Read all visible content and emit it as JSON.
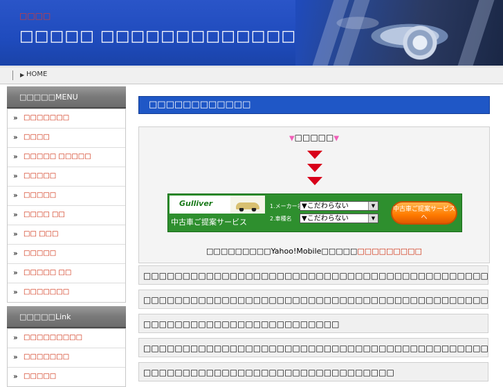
{
  "header": {
    "pretitle": "□□□□",
    "title": "□□□□□ □□□□□□□□□□□□□"
  },
  "breadcrumb": {
    "home": "HOME"
  },
  "sidebar": {
    "menu_title": "□□□□□MENU",
    "menu_items": [
      "□□□□□□□",
      "□□□□",
      "□□□□□ □□□□□",
      "□□□□□",
      "□□□□□",
      "□□□□ □□",
      "□□ □□□",
      "□□□□□",
      "□□□□□ □□",
      "□□□□□□□"
    ],
    "link_title": "□□□□□Link",
    "link_items": [
      "□□□□□□□□□",
      "□□□□□□□",
      "□□□□□"
    ]
  },
  "main": {
    "title": "□□□□□□□□□□□□",
    "promo": {
      "heading": "□□□□□",
      "banner": {
        "brand": "Gulliver",
        "service": "中古車ご提案サービス",
        "label_maker": "1.メーカー名",
        "label_model": "2.車種名",
        "select_maker": "▼こだわらない",
        "select_model": "▼こだわらない",
        "cta": "中古車ご提案サービスへ"
      },
      "footer_text": "□□□□□□□□□Yahoo!Mobile□□□□□",
      "footer_link": "□□□□□□□□□"
    },
    "items": [
      "□□□□□□□□□□□□□□□□□□□□□□□□□□□□□□□□□□□□□□□□□□□□□□□",
      "□□□□□□□□□□□□□□□□□□□□□□□□□□□□□□□□□□□□□□□□□□□□",
      "□□□□□□□□□□□□□□□□□□□□□□□□□",
      "□□□□□□□□□□□□□□□□□□□□□□□□□□□□□□□□□□□□□□□□□□□□□□□□□□□□□□□□□□□□□□",
      "□□□□□□□□□□□□□□□□□□□□□□□□□□□□□□□□"
    ]
  }
}
